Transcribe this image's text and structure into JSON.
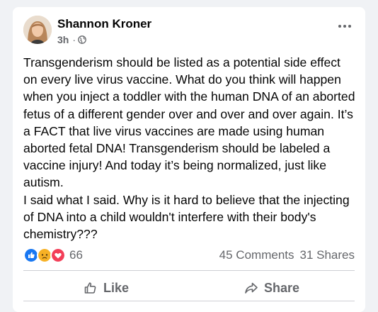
{
  "post": {
    "author": "Shannon Kroner",
    "time": "3h",
    "separator": "·",
    "privacy_icon": "globe-icon",
    "text": "Transgenderism should be listed as a potential side effect on every live virus vaccine. What do you think will happen when you inject a toddler with the human DNA of an aborted fetus of a different gender over and over and over again. It’s a FACT that live virus vaccines are made using human aborted fetal DNA! Transgenderism should be labeled a vaccine injury! And today it’s being normalized, just like autism.\nI said what I said. Why is it hard to believe that the injecting of DNA into a child wouldn't interfere with their body's chemistry???"
  },
  "stats": {
    "reaction_icons": [
      "like-icon",
      "sad-icon",
      "love-icon"
    ],
    "reaction_count": "66",
    "comments": "45 Comments",
    "shares": "31 Shares"
  },
  "actions": {
    "like_label": "Like",
    "share_label": "Share"
  },
  "colors": {
    "like_blue": "#1877f2",
    "love_red": "#f33e58",
    "sad_yellow": "#f7b125",
    "secondary_text": "#65676b"
  }
}
